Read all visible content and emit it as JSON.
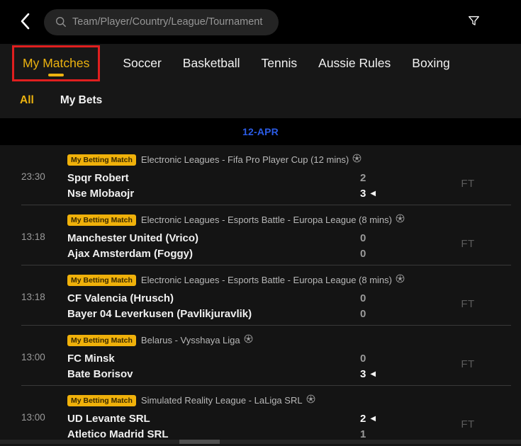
{
  "header": {
    "search_placeholder": "Team/Player/Country/League/Tournament"
  },
  "tabs": [
    {
      "label": "My Matches",
      "active": true
    },
    {
      "label": "Soccer",
      "active": false
    },
    {
      "label": "Basketball",
      "active": false
    },
    {
      "label": "Tennis",
      "active": false
    },
    {
      "label": "Aussie Rules",
      "active": false
    },
    {
      "label": "Boxing",
      "active": false
    }
  ],
  "subtabs": [
    {
      "label": "All",
      "active": true
    },
    {
      "label": "My Bets",
      "active": false
    }
  ],
  "date_header": "12-APR",
  "badge_label": "My Betting Match",
  "status_label": "FT",
  "matches": [
    {
      "time": "23:30",
      "league": "Electronic Leagues - Fifa Pro Player Cup (12 mins)",
      "teams": [
        {
          "name": "Spqr Robert",
          "score": "2",
          "winner": false
        },
        {
          "name": "Nse Mlobaojr",
          "score": "3",
          "winner": true
        }
      ]
    },
    {
      "time": "13:18",
      "league": "Electronic Leagues - Esports Battle - Europa League (8 mins)",
      "teams": [
        {
          "name": "Manchester United (Vrico)",
          "score": "0",
          "winner": false
        },
        {
          "name": "Ajax Amsterdam (Foggy)",
          "score": "0",
          "winner": false
        }
      ]
    },
    {
      "time": "13:18",
      "league": "Electronic Leagues - Esports Battle - Europa League (8 mins)",
      "teams": [
        {
          "name": "CF Valencia (Hrusch)",
          "score": "0",
          "winner": false
        },
        {
          "name": "Bayer 04 Leverkusen (Pavlikjuravlik)",
          "score": "0",
          "winner": false
        }
      ]
    },
    {
      "time": "13:00",
      "league": "Belarus - Vysshaya Liga",
      "teams": [
        {
          "name": "FC Minsk",
          "score": "0",
          "winner": false
        },
        {
          "name": "Bate Borisov",
          "score": "3",
          "winner": true
        }
      ]
    },
    {
      "time": "13:00",
      "league": "Simulated Reality League - LaLiga SRL",
      "teams": [
        {
          "name": "UD Levante SRL",
          "score": "2",
          "winner": true
        },
        {
          "name": "Atletico Madrid SRL",
          "score": "1",
          "winner": false
        }
      ]
    }
  ],
  "colors": {
    "accent_yellow": "#edb30f",
    "badge_yellow": "#f0b10a",
    "date_blue": "#2b5ce6",
    "annotation_red": "#e01f1f",
    "list_background": "#141414",
    "bar_background": "#171717"
  }
}
